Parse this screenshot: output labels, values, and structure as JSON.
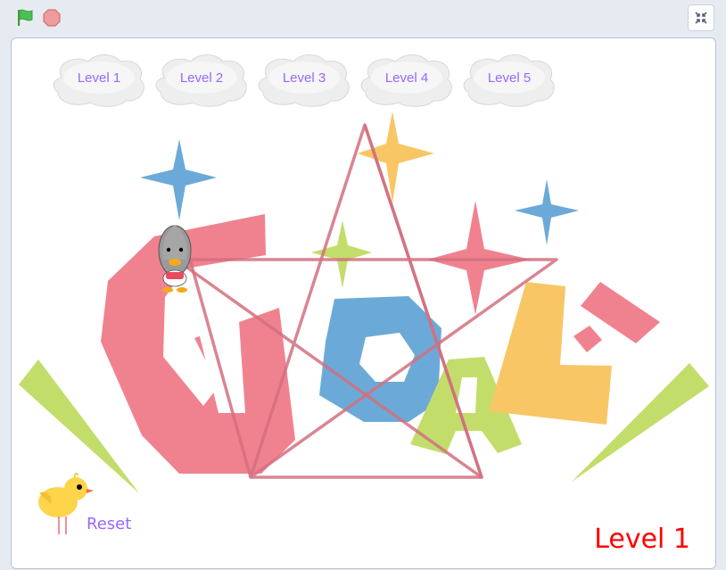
{
  "toolbar": {
    "green_flag": "green-flag-icon",
    "stop": "stop-sign-icon",
    "fullscreen": "exit-fullscreen-icon"
  },
  "level_buttons": [
    {
      "label": "Level 1"
    },
    {
      "label": "Level 2"
    },
    {
      "label": "Level 3"
    },
    {
      "label": "Level 4"
    },
    {
      "label": "Level 5"
    }
  ],
  "reset": {
    "label": "Reset"
  },
  "level_indicator": "Level 1",
  "colors": {
    "label_purple": "#9966ff",
    "level_red": "#ff0000",
    "goal_pink": "#f08290",
    "goal_blue": "#6baad8",
    "goal_green": "#c3dd6b",
    "goal_yellow": "#f8c665",
    "star_path": "#d2707f"
  }
}
